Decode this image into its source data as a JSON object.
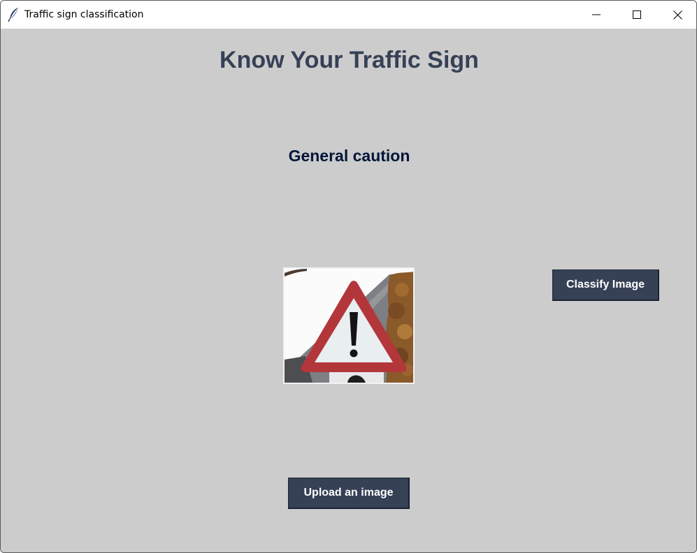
{
  "window": {
    "title": "Traffic sign classification",
    "icon": "feather-icon",
    "controls": [
      "minimize-icon",
      "maximize-icon",
      "close-icon"
    ]
  },
  "main": {
    "heading": "Know Your Traffic Sign",
    "result_label": "General caution",
    "uploaded_image": "general-caution-sign-image",
    "classify_button_label": "Classify Image",
    "upload_button_label": "Upload an image"
  },
  "colors": {
    "background": "#cccccc",
    "heading": "#364156",
    "result": "#011638",
    "button_bg": "#364156",
    "button_text": "#ffffff"
  }
}
